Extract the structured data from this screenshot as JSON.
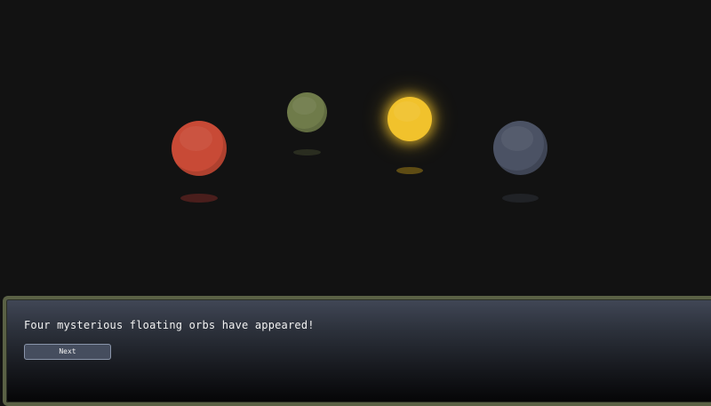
{
  "scene": {
    "background": "#121212",
    "orbs": [
      {
        "name": "red-orb",
        "color": "#c84a36",
        "shadow": "#4a1e1c",
        "glow": false
      },
      {
        "name": "green-orb",
        "color": "#6f7b4a",
        "shadow": "#2a2d20",
        "glow": false
      },
      {
        "name": "yellow-orb",
        "color": "#f1c22c",
        "shadow": "#5e4c14",
        "glow": true
      },
      {
        "name": "slate-orb",
        "color": "#4b5264",
        "shadow": "#202226",
        "glow": false
      }
    ]
  },
  "dialog": {
    "message": "Four mysterious floating orbs have appeared!",
    "next_label": "Next",
    "border_color": "#5a6145"
  }
}
